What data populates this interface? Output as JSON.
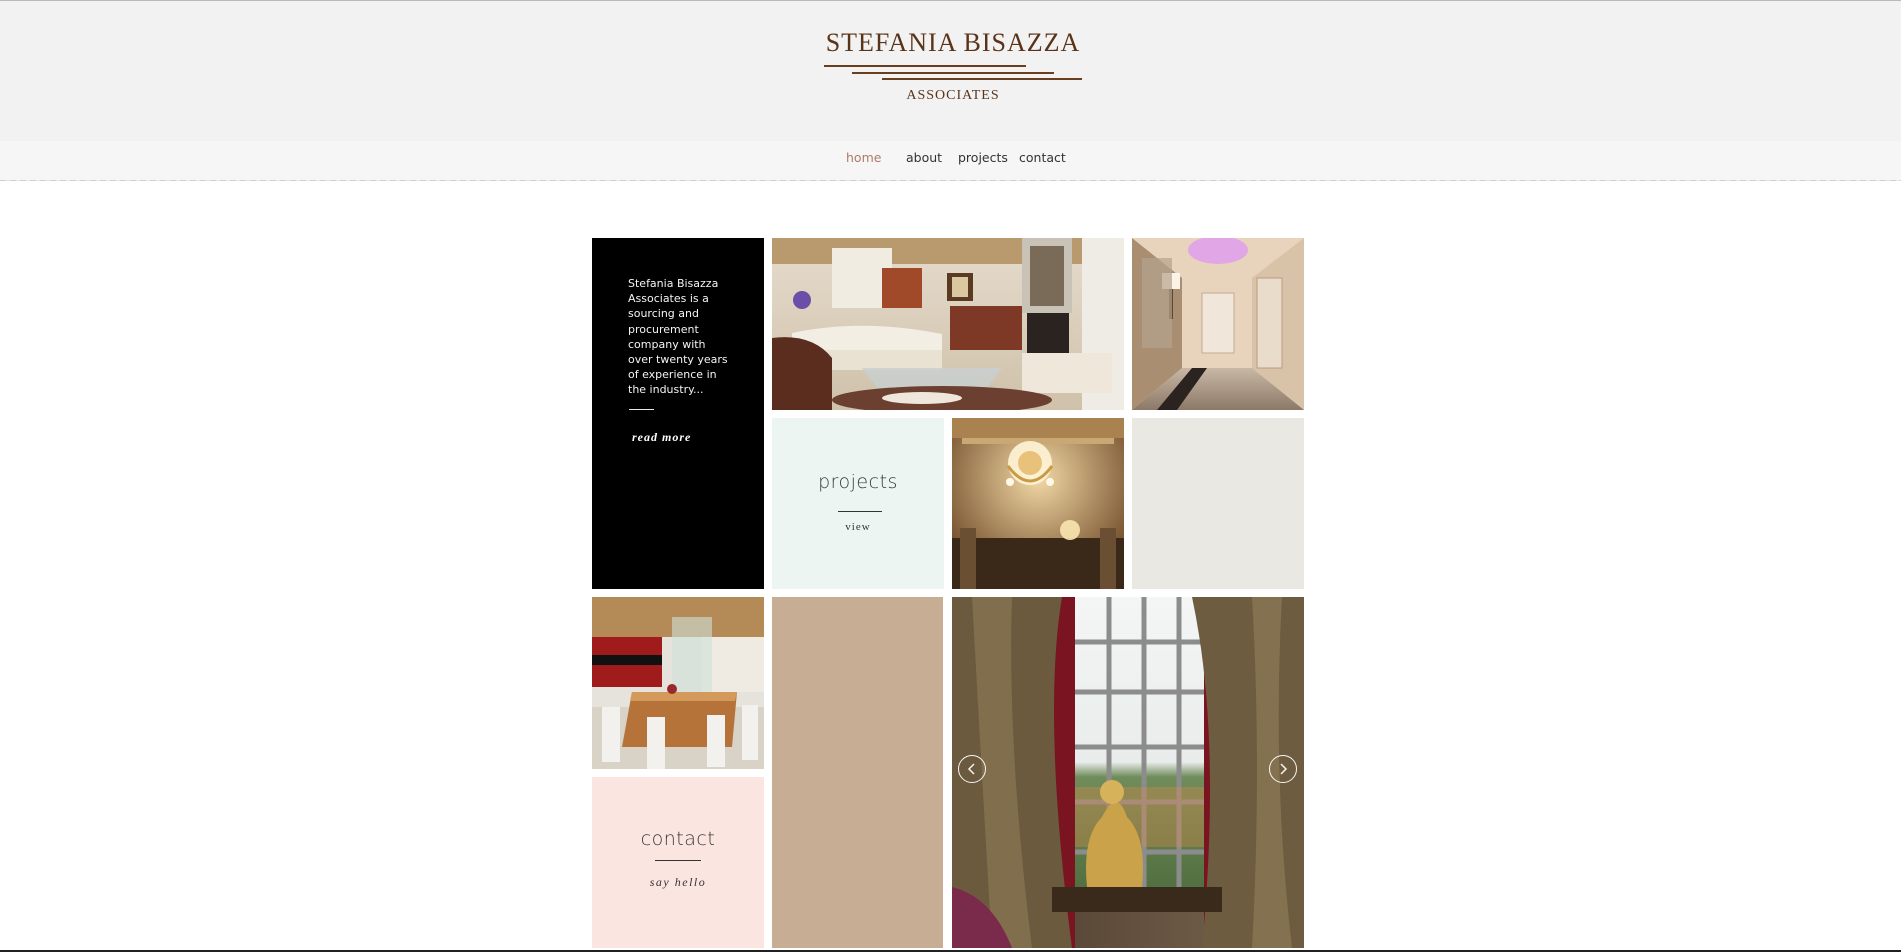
{
  "logo": {
    "title": "STEFANIA BISAZZA",
    "subtitle": "ASSOCIATES",
    "color": "#5a3418"
  },
  "nav": {
    "items": [
      {
        "label": "home",
        "active": true
      },
      {
        "label": "about",
        "active": false
      },
      {
        "label": "projects",
        "active": false
      },
      {
        "label": "contact",
        "active": false
      }
    ],
    "active_color": "#b07a6a"
  },
  "about_tile": {
    "text": "Stefania Bisazza Associates is a sourcing and procurement company with over twenty years of experience in the industry...",
    "link": "read more"
  },
  "projects_tile": {
    "heading": "projects",
    "link": "view",
    "background": "#ecf5f2"
  },
  "contact_tile": {
    "heading": "contact",
    "link": "say hello",
    "background": "#fbe5e0"
  },
  "colors": {
    "header_bg": "#f3f2f2",
    "tan_tile": "#c6ad94",
    "grey_tile": "#e9e8e3",
    "about_bg": "#000000"
  },
  "images": [
    "living-room-photo",
    "hallway-photo",
    "chandelier-ceiling-photo",
    "dining-room-photo",
    "window-curtains-photo"
  ],
  "slideshow": {
    "controls": [
      "arrow-left-icon",
      "arrow-right-icon"
    ]
  }
}
